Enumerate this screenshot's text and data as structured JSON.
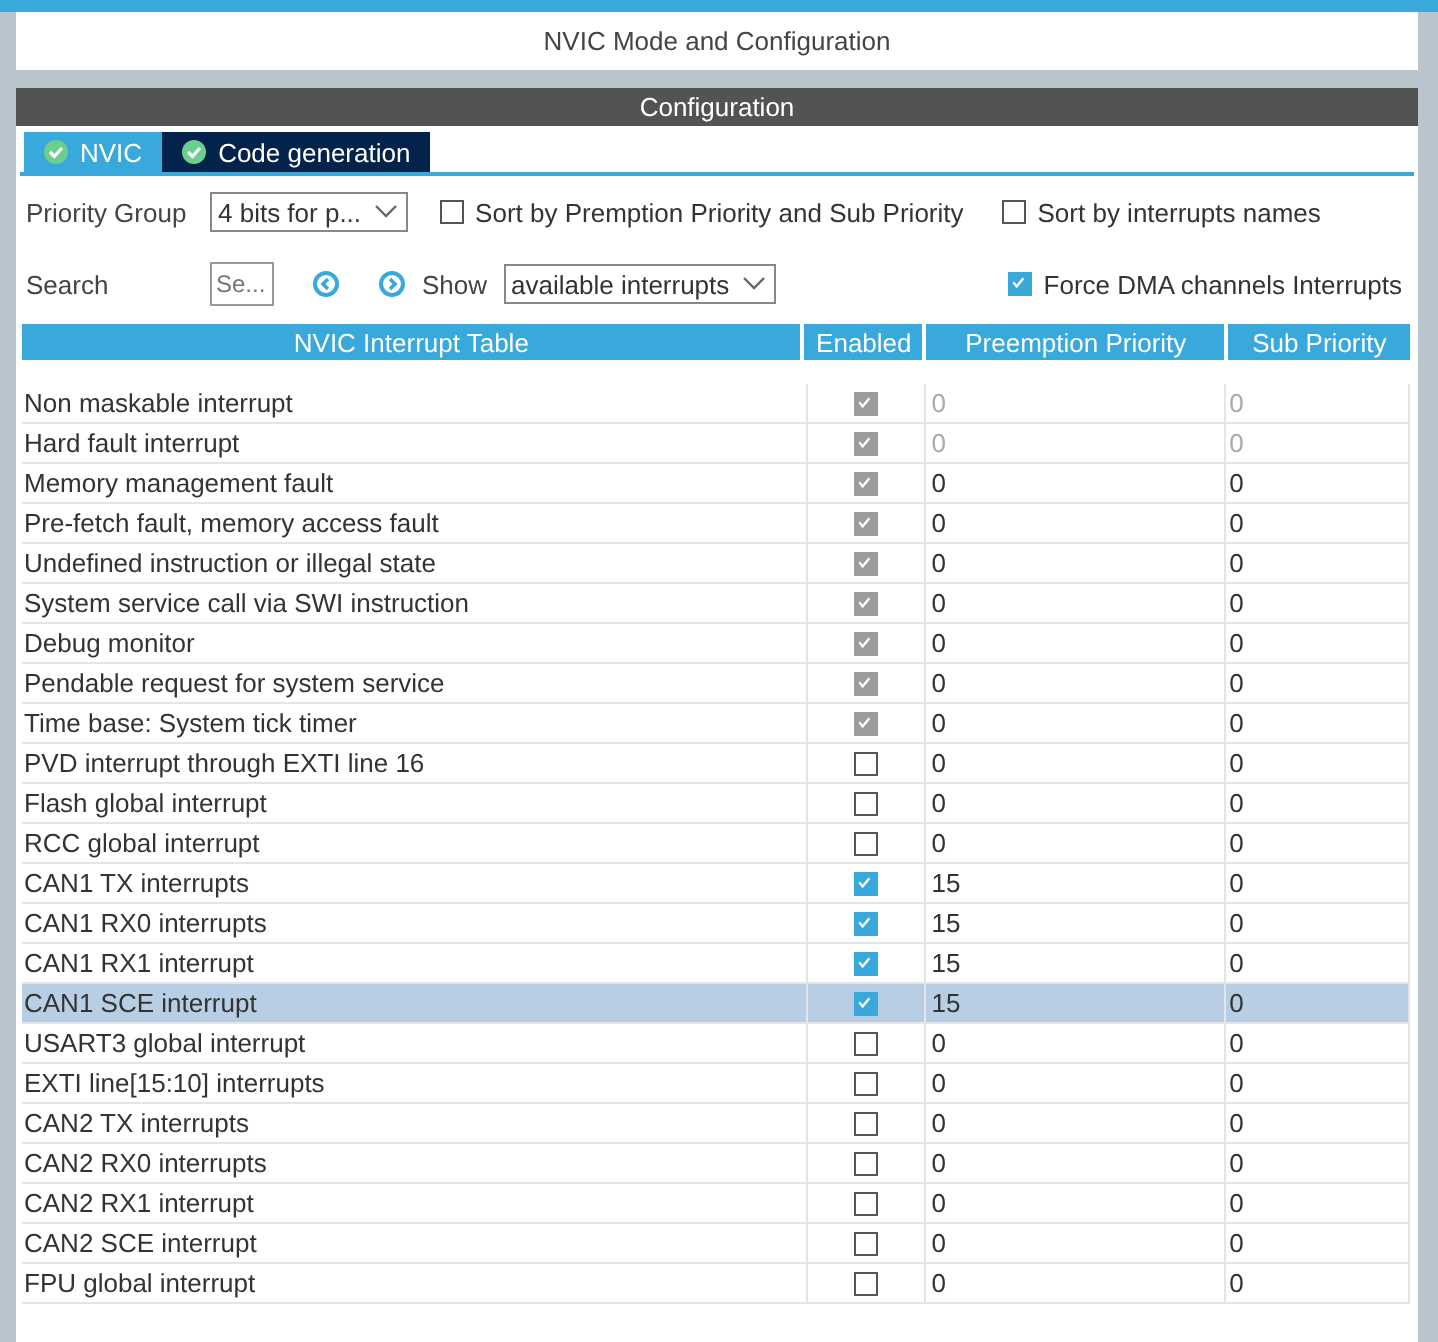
{
  "window": {
    "title": "NVIC Mode and Configuration"
  },
  "section": {
    "title": "Configuration"
  },
  "tabs": [
    {
      "label": "NVIC",
      "selected": true,
      "ok": true
    },
    {
      "label": "Code generation",
      "selected": false,
      "ok": true
    }
  ],
  "controls": {
    "priority_group": {
      "label": "Priority Group",
      "value": "4 bits for p..."
    },
    "sort_premption": {
      "label": "Sort by Premption Priority and Sub Priority",
      "checked": false
    },
    "sort_names": {
      "label": "Sort by interrupts names",
      "checked": false
    },
    "search": {
      "label": "Search",
      "placeholder": "Se..."
    },
    "show": {
      "label": "Show",
      "value": "available interrupts"
    },
    "force_dma": {
      "label": "Force DMA channels Interrupts",
      "checked": true
    }
  },
  "table": {
    "columns": [
      "NVIC Interrupt Table",
      "Enabled",
      "Preemption Priority",
      "Sub Priority"
    ],
    "rows": [
      {
        "name": "Non maskable interrupt",
        "enabled": true,
        "locked": true,
        "values_greyed": true,
        "preemption": "0",
        "sub": "0",
        "selected": false
      },
      {
        "name": "Hard fault interrupt",
        "enabled": true,
        "locked": true,
        "values_greyed": true,
        "preemption": "0",
        "sub": "0",
        "selected": false
      },
      {
        "name": "Memory management fault",
        "enabled": true,
        "locked": true,
        "values_greyed": false,
        "preemption": "0",
        "sub": "0",
        "selected": false
      },
      {
        "name": "Pre-fetch fault, memory access fault",
        "enabled": true,
        "locked": true,
        "values_greyed": false,
        "preemption": "0",
        "sub": "0",
        "selected": false
      },
      {
        "name": "Undefined instruction or illegal state",
        "enabled": true,
        "locked": true,
        "values_greyed": false,
        "preemption": "0",
        "sub": "0",
        "selected": false
      },
      {
        "name": "System service call via SWI instruction",
        "enabled": true,
        "locked": true,
        "values_greyed": false,
        "preemption": "0",
        "sub": "0",
        "selected": false
      },
      {
        "name": "Debug monitor",
        "enabled": true,
        "locked": true,
        "values_greyed": false,
        "preemption": "0",
        "sub": "0",
        "selected": false
      },
      {
        "name": "Pendable request for system service",
        "enabled": true,
        "locked": true,
        "values_greyed": false,
        "preemption": "0",
        "sub": "0",
        "selected": false
      },
      {
        "name": "Time base: System tick timer",
        "enabled": true,
        "locked": true,
        "values_greyed": false,
        "preemption": "0",
        "sub": "0",
        "selected": false
      },
      {
        "name": "PVD interrupt through EXTI line 16",
        "enabled": false,
        "locked": false,
        "values_greyed": false,
        "preemption": "0",
        "sub": "0",
        "selected": false
      },
      {
        "name": "Flash global interrupt",
        "enabled": false,
        "locked": false,
        "values_greyed": false,
        "preemption": "0",
        "sub": "0",
        "selected": false
      },
      {
        "name": "RCC global interrupt",
        "enabled": false,
        "locked": false,
        "values_greyed": false,
        "preemption": "0",
        "sub": "0",
        "selected": false
      },
      {
        "name": "CAN1 TX interrupts",
        "enabled": true,
        "locked": false,
        "values_greyed": false,
        "preemption": "15",
        "sub": "0",
        "selected": false
      },
      {
        "name": "CAN1 RX0 interrupts",
        "enabled": true,
        "locked": false,
        "values_greyed": false,
        "preemption": "15",
        "sub": "0",
        "selected": false
      },
      {
        "name": "CAN1 RX1 interrupt",
        "enabled": true,
        "locked": false,
        "values_greyed": false,
        "preemption": "15",
        "sub": "0",
        "selected": false
      },
      {
        "name": "CAN1 SCE interrupt",
        "enabled": true,
        "locked": false,
        "values_greyed": false,
        "preemption": "15",
        "sub": "0",
        "selected": true
      },
      {
        "name": "USART3 global interrupt",
        "enabled": false,
        "locked": false,
        "values_greyed": false,
        "preemption": "0",
        "sub": "0",
        "selected": false
      },
      {
        "name": "EXTI line[15:10] interrupts",
        "enabled": false,
        "locked": false,
        "values_greyed": false,
        "preemption": "0",
        "sub": "0",
        "selected": false
      },
      {
        "name": "CAN2 TX interrupts",
        "enabled": false,
        "locked": false,
        "values_greyed": false,
        "preemption": "0",
        "sub": "0",
        "selected": false
      },
      {
        "name": "CAN2 RX0 interrupts",
        "enabled": false,
        "locked": false,
        "values_greyed": false,
        "preemption": "0",
        "sub": "0",
        "selected": false
      },
      {
        "name": "CAN2 RX1 interrupt",
        "enabled": false,
        "locked": false,
        "values_greyed": false,
        "preemption": "0",
        "sub": "0",
        "selected": false
      },
      {
        "name": "CAN2 SCE interrupt",
        "enabled": false,
        "locked": false,
        "values_greyed": false,
        "preemption": "0",
        "sub": "0",
        "selected": false
      },
      {
        "name": "FPU global interrupt",
        "enabled": false,
        "locked": false,
        "values_greyed": false,
        "preemption": "0",
        "sub": "0",
        "selected": false
      }
    ]
  }
}
